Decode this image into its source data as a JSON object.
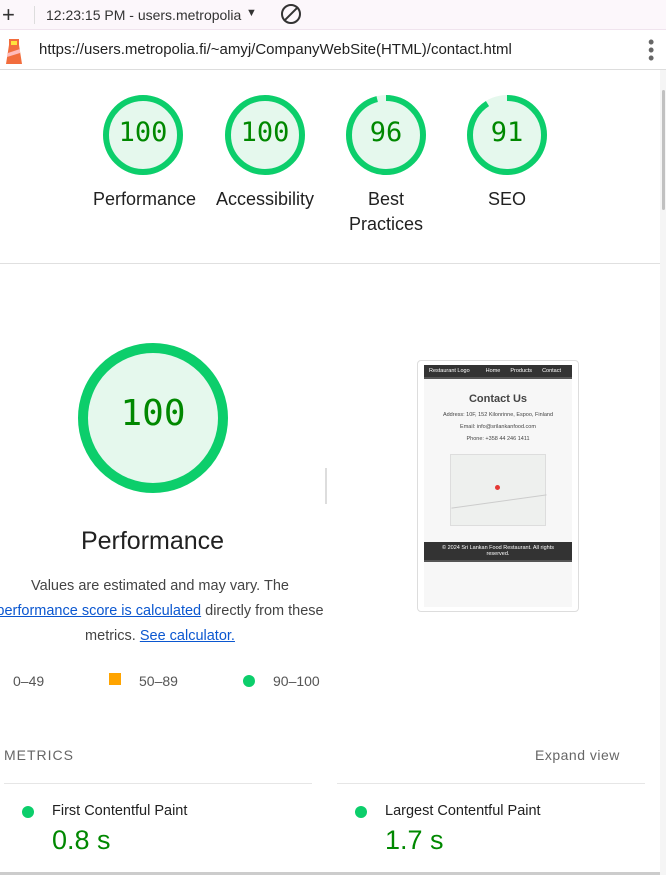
{
  "browser": {
    "tab_title": "12:23:15 PM - users.metropolia",
    "url": "https://users.metropolia.fi/~amyj/CompanyWebSite(HTML)/contact.html"
  },
  "colors": {
    "pass": "#0cce6b",
    "average": "#ffa400",
    "fail": "#ff4e42",
    "score_text": "#008800"
  },
  "summary": [
    {
      "label": "Performance",
      "score": 100
    },
    {
      "label": "Accessibility",
      "score": 100
    },
    {
      "label": "Best Practices",
      "score": 96
    },
    {
      "label": "SEO",
      "score": 91
    }
  ],
  "main": {
    "score": 100,
    "title": "Performance",
    "desc_pre": "Values are estimated and may vary. The ",
    "desc_link": "performance score is calculated",
    "desc_mid": " directly from these metrics. ",
    "desc_link2": "See calculator."
  },
  "legend": [
    {
      "label": "0–49"
    },
    {
      "label": "50–89"
    },
    {
      "label": "90–100"
    }
  ],
  "screenshot": {
    "logo": "Restaurant Logo",
    "nav": [
      "Home",
      "Products",
      "Contact"
    ],
    "heading": "Contact Us",
    "address": "Address: 10F, 152 Kilonrinne, Espoo, Finland",
    "email": "Email: info@srilankanfood.com",
    "phone": "Phone: +358 44 246 1411",
    "footer": "© 2024 Sri Lankan Food Restaurant. All rights reserved."
  },
  "metrics": {
    "header": "METRICS",
    "expand": "Expand view",
    "items": [
      {
        "label": "First Contentful Paint",
        "value": "0.8 s"
      },
      {
        "label": "Largest Contentful Paint",
        "value": "1.7 s"
      }
    ]
  }
}
